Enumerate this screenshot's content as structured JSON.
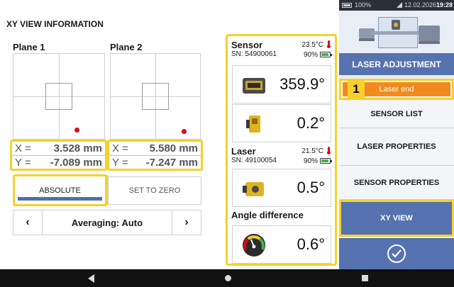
{
  "page_title": "XY VIEW INFORMATION",
  "planes": [
    {
      "label": "Plane 1",
      "x_label": "X =",
      "x_value": "3.528 mm",
      "y_label": "Y =",
      "y_value": "-7.089 mm"
    },
    {
      "label": "Plane 2",
      "x_label": "X =",
      "x_value": "5.580 mm",
      "y_label": "Y =",
      "y_value": "-7.247 mm"
    }
  ],
  "mode": {
    "absolute_label": "ABSOLUTE",
    "set_zero_label": "SET TO ZERO",
    "active": "ABSOLUTE"
  },
  "averaging": {
    "label": "Averaging: Auto",
    "prev_icon": "chevron-left-icon",
    "next_icon": "chevron-right-icon"
  },
  "sensor": {
    "name": "Sensor",
    "sn": "SN: 54900061",
    "temperature": "23.5°C",
    "battery": "90%",
    "value_1": "359.9°",
    "value_2": "0.2°"
  },
  "laser": {
    "name": "Laser",
    "sn": "SN: 49100054",
    "temperature": "21.5°C",
    "battery": "90%",
    "value": "0.5°"
  },
  "angle_difference": {
    "title": "Angle difference",
    "value": "0.6°"
  },
  "status_bar": {
    "battery": "100%",
    "date": "12.02.2026",
    "time": "19:28"
  },
  "menu": {
    "header": "LASER ADJUSTMENT",
    "callout_number": "1",
    "laser_end": "Laser end",
    "sensor_list": "SENSOR LIST",
    "laser_properties": "LASER PROPERTIES",
    "sensor_properties": "SENSOR PROPERTIES",
    "xy_view": "XY VIEW"
  },
  "colors": {
    "accent_blue": "#5673b0",
    "highlight_yellow": "#f7d02b",
    "laser_end_orange": "#f28b1e",
    "point_red": "#e30613"
  }
}
